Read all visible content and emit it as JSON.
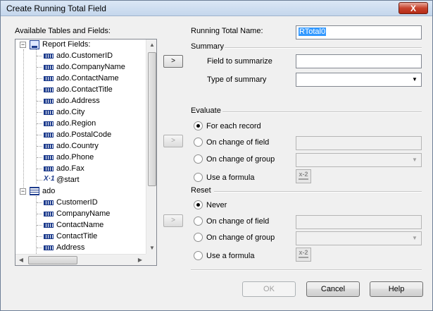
{
  "window": {
    "title": "Create Running Total Field",
    "close_label": "X"
  },
  "left": {
    "label": "Available Tables and Fields:",
    "tree": {
      "report_fields_label": "Report Fields:",
      "report_fields": [
        "ado.CustomerID",
        "ado.CompanyName",
        "ado.ContactName",
        "ado.ContactTitle",
        "ado.Address",
        "ado.City",
        "ado.Region",
        "ado.PostalCode",
        "ado.Country",
        "ado.Phone",
        "ado.Fax"
      ],
      "formula_item": "@start",
      "ado_label": "ado",
      "ado_fields": [
        "CustomerID",
        "CompanyName",
        "ContactName",
        "ContactTitle",
        "Address"
      ]
    }
  },
  "right": {
    "name_label": "Running Total Name:",
    "name_value": "RTotal0",
    "summary": {
      "heading": "Summary",
      "field_label": "Field to summarize",
      "field_value": "",
      "type_label": "Type of summary",
      "type_value": ""
    },
    "evaluate": {
      "heading": "Evaluate",
      "options": [
        "For each record",
        "On change of field",
        "On change of group",
        "Use a formula"
      ],
      "selected": 0
    },
    "reset": {
      "heading": "Reset",
      "options": [
        "Never",
        "On change of field",
        "On change of group",
        "Use a formula"
      ],
      "selected": 0
    }
  },
  "buttons": {
    "ok": "OK",
    "cancel": "Cancel",
    "help": "Help",
    "move": ">"
  },
  "icons": {
    "dropdown": "▼",
    "formula_editor": "x-2"
  }
}
